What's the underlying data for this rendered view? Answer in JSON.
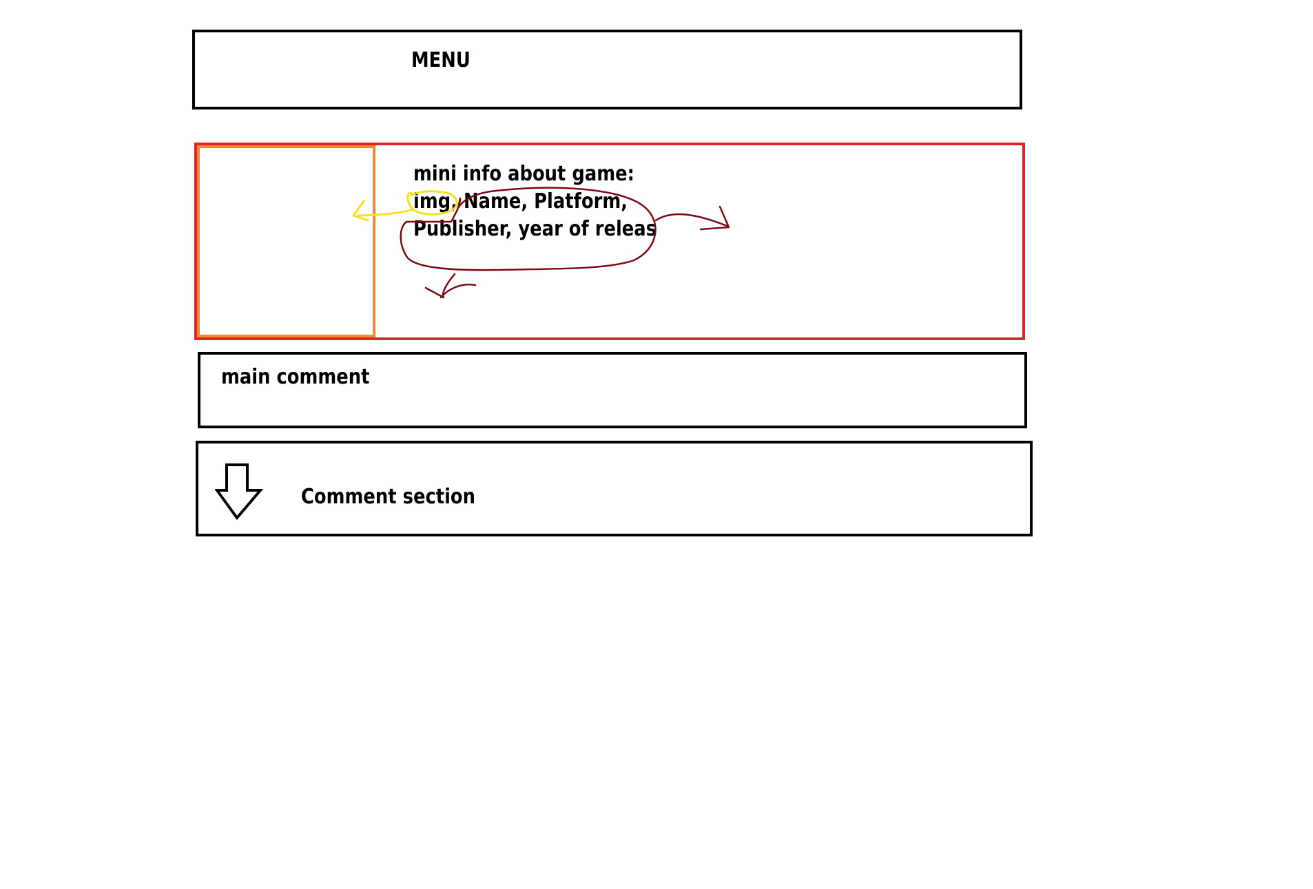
{
  "menu": {
    "label": "MENU"
  },
  "game_info": {
    "lines": [
      "mini info about game:",
      "img, Name, Platform,",
      "Publisher, year of releas"
    ],
    "box_color": "#e0252a",
    "image_placeholder_color": "#f28a2e",
    "highlight_color": "#f5e11e",
    "annotation_color": "#7a0a12"
  },
  "main_comment": {
    "label": "main comment"
  },
  "comment_section": {
    "label": "Comment section",
    "icon": "down-arrow-icon"
  }
}
